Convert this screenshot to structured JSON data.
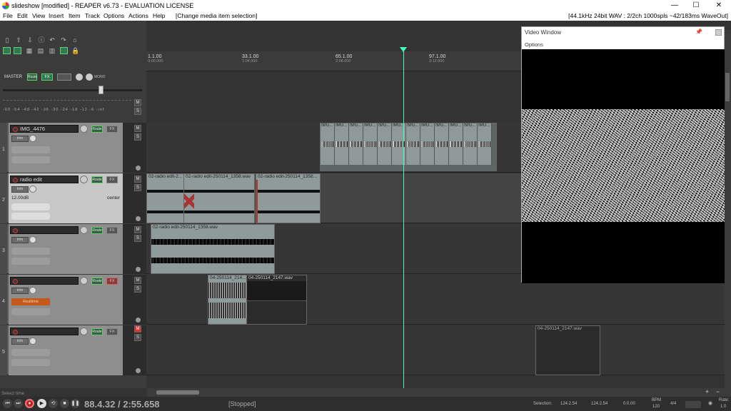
{
  "window": {
    "title": "slideshow [modified] - REAPER v6.73 - EVALUATION LICENSE",
    "minimize": "—",
    "maximize": "☐",
    "close": "✕"
  },
  "menu": {
    "items": [
      "File",
      "Edit",
      "View",
      "Insert",
      "Item",
      "Track",
      "Options",
      "Actions",
      "Help"
    ],
    "hint": "[Change media item selection]",
    "status": "[44.1kHz 24bit WAV : 2/2ch 1000spls ~42/183ms WaveOut]"
  },
  "master": {
    "label": "MASTER",
    "route": "Route",
    "fx": "FX",
    "mono": "MONO",
    "scale": "-60  -54  -48  -42  -36  -30  -24  -18  -12   -6        -inf"
  },
  "ruler": {
    "marks": [
      {
        "label": "1.1.00",
        "time": "0:00.000"
      },
      {
        "label": "33.1.00",
        "time": "1:04.000"
      },
      {
        "label": "65.1.00",
        "time": "2:08.000"
      },
      {
        "label": "97.1.00",
        "time": "3:12.000"
      }
    ]
  },
  "tracks": [
    {
      "num": "1",
      "name": "IMG_4476",
      "route": "Route",
      "fx": "FX",
      "env": "trim",
      "mute": "M",
      "solo": "S"
    },
    {
      "num": "2",
      "name": "radio edit",
      "route": "Route",
      "fx": "FX",
      "env": "trim",
      "mute": "M",
      "solo": "S",
      "volume": "12.00dB",
      "pan": "center"
    },
    {
      "num": "3",
      "name": "",
      "route": "Route",
      "fx": "FX",
      "env": "trim",
      "mute": "M",
      "solo": "S"
    },
    {
      "num": "4",
      "name": "",
      "route": "Route",
      "fx": "FX",
      "env": "trim",
      "mute": "M",
      "solo": "S",
      "recinput": "Realtime"
    },
    {
      "num": "5",
      "name": "",
      "route": "Route",
      "fx": "FX",
      "env": "trim",
      "mute": "M",
      "solo": "S"
    }
  ],
  "items": {
    "img_label": "IMG...",
    "radio1": "02-radio edit-2...",
    "radio2": "02-radio edit-250114_1358.wav",
    "radio3": "02-radio edit-250114_1358...",
    "radio4": "02-radio edit-250114_1358.wav",
    "track4a": "04-250114_214...",
    "track4b": "04-250114_2147.wav",
    "track5": "04-250114_2147.wav"
  },
  "video": {
    "title": "Video Window",
    "options": "Options"
  },
  "transport": {
    "time": "88.4.32 / 2:55.658",
    "state": "[Stopped]",
    "selection_label": "Selection:",
    "sel_start": "124.2.54",
    "sel_end": "124.2.54",
    "sel_len": "0.0.00",
    "bpm_label": "BPM",
    "bpm": "120",
    "sig": "4/4",
    "rate_label": "Rate:",
    "rate": "1.0"
  },
  "status": {
    "select_time": "Select time"
  },
  "colors": {
    "accent": "#44ffaa",
    "record": "#dd3333",
    "bg": "#333333"
  }
}
